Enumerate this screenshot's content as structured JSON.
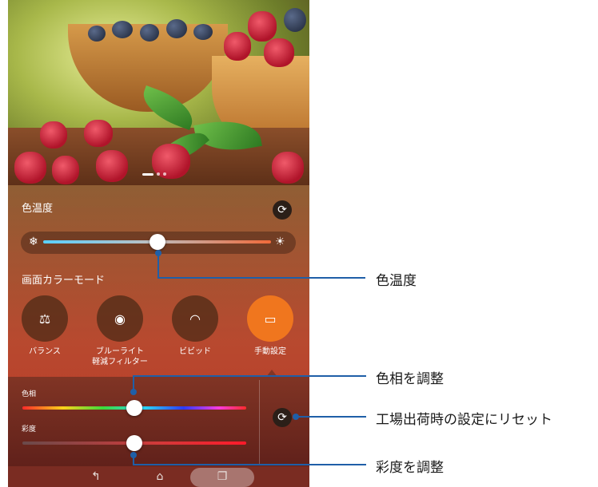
{
  "panel": {
    "color_temp_title": "色温度",
    "screen_mode_title": "画面カラーモード",
    "cold_icon": "❄",
    "warm_icon": "☀",
    "reset_icon": "⟳",
    "temperature_level": 0.5
  },
  "modes": [
    {
      "label": "バランス",
      "icon": "balance-icon",
      "glyph": "⚖",
      "active": false
    },
    {
      "label": "ブルーライト\n軽減フィルター",
      "icon": "eye-shield-icon",
      "glyph": "◉",
      "active": false
    },
    {
      "label": "ビビッド",
      "icon": "rainbow-icon",
      "glyph": "◠",
      "active": false
    },
    {
      "label": "手動設定",
      "icon": "manual-settings-icon",
      "glyph": "▭",
      "active": true
    }
  ],
  "adjust": {
    "hue_label": "色相",
    "saturation_label": "彩度",
    "hue_level": 0.5,
    "saturation_level": 0.5
  },
  "navbar": {
    "back_icon": "↰",
    "home_icon": "⌂",
    "recent_icon": "❐"
  },
  "callouts": {
    "color_temp": "色温度",
    "hue": "色相を調整",
    "reset": "工場出荷時の設定にリセット",
    "saturation": "彩度を調整"
  },
  "colors": {
    "accent": "#f0761e",
    "callout": "#1f5fa8"
  }
}
